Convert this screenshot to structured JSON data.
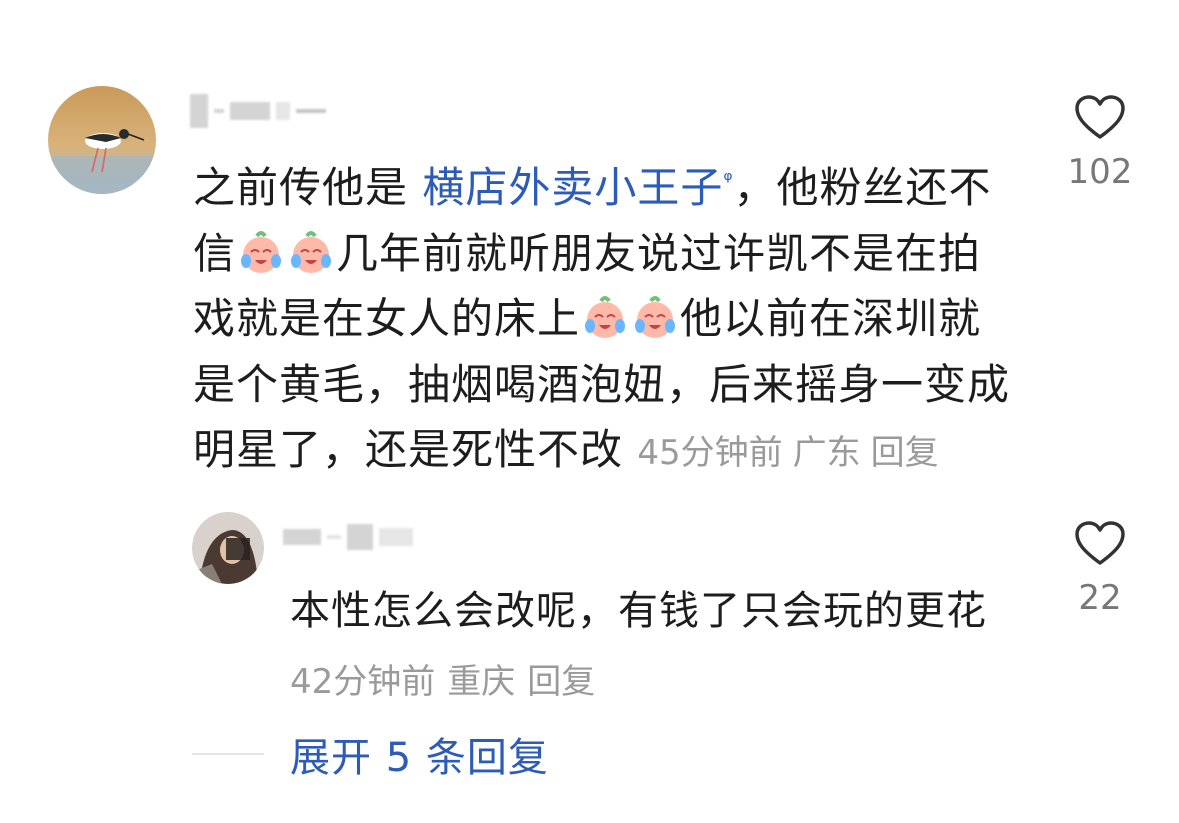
{
  "comment": {
    "author_blurred": true,
    "text_before_topic": "之前传他是 ",
    "topic_link": "横店外卖小王子",
    "text_after_topic_line1": "，他粉丝还不",
    "line2_start": "信",
    "line2_after_emoji": "几年前就听朋友说过许凯不是在拍",
    "line3_start": "戏就是在女人的床上",
    "line3_after_emoji": "他以前在深圳就",
    "line4": "是个黄毛，抽烟喝酒泡妞，后来摇身一变成",
    "line5": "明星了，还是死性不改",
    "time": "45分钟前",
    "location": "广东",
    "reply_label": "回复",
    "likes": "102"
  },
  "reply": {
    "author_blurred": true,
    "text": "本性怎么会改呢，有钱了只会玩的更花",
    "time": "42分钟前",
    "location": "重庆",
    "reply_label": "回复",
    "likes": "22"
  },
  "expand": {
    "label": "展开 5 条回复"
  },
  "icons": {
    "like": "heart-outline-icon",
    "topic_search": "search-icon",
    "emoji": "crying-laughing-emoji-icon"
  },
  "colors": {
    "link_blue": "#2c5bb8",
    "meta_gray": "#9a9a9a",
    "text_dark": "#1d1d1d"
  }
}
